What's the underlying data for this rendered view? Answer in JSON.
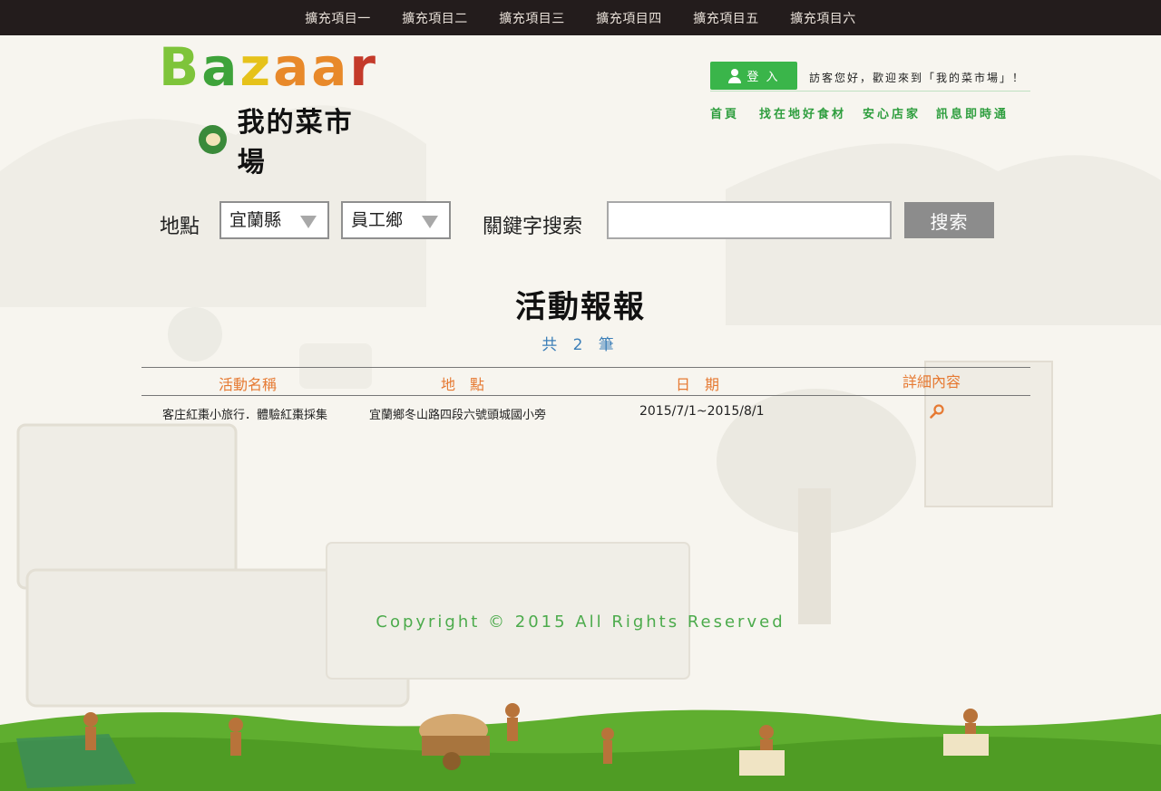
{
  "top_nav": {
    "items": [
      "擴充項目一",
      "擴充項目二",
      "擴充項目三",
      "擴充項目四",
      "擴充項目五",
      "擴充項目六"
    ]
  },
  "logo": {
    "letters": [
      "B",
      "a",
      "z",
      "a",
      "a",
      "r"
    ],
    "letter_colors": [
      "#7ec43a",
      "#3ea33a",
      "#e6c21a",
      "#e8892a",
      "#e8892a",
      "#c43a2a"
    ],
    "subtitle": "我的菜市場"
  },
  "header": {
    "login_label": "登 入",
    "welcome": "訪客您好，歡迎來到「我的菜市場」！",
    "nav": [
      "首頁",
      "找在地好食材",
      "安心店家",
      "訊息即時通"
    ]
  },
  "search": {
    "location_label": "地點",
    "county": "宜蘭縣",
    "township": "員工鄉",
    "keyword_label": "關鍵字搜索",
    "keyword_value": "",
    "button_label": "搜索"
  },
  "main": {
    "title": "活動報報",
    "count": "共 2 筆"
  },
  "table": {
    "headers": [
      "活動名稱",
      "地　點",
      "日　期",
      "詳細內容"
    ],
    "rows": [
      {
        "name": "客庄紅棗小旅行．體驗紅棗採集",
        "location": "宜蘭鄉冬山路四段六號頭城國小旁",
        "date": "2015/7/1~2015/8/1",
        "detail_icon": "magnifier-icon"
      }
    ]
  },
  "footer": {
    "copyright": "Copyright © 2015 All Rights Reserved"
  },
  "colors": {
    "top_nav_bg": "#231c1c",
    "accent_green": "#3ab54a",
    "header_orange": "#e67a33",
    "count_blue": "#3c7fb8",
    "button_gray": "#8c8c8c"
  }
}
